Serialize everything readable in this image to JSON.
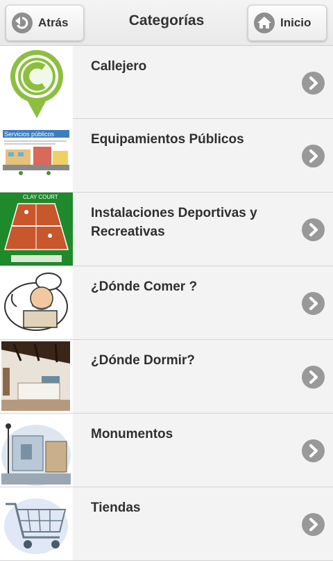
{
  "header": {
    "back_label": "Atrás",
    "title": "Categorías",
    "home_label": "Inicio"
  },
  "thumb_texts": {
    "servicios": "Servicios públicos",
    "clay": "CLAY COURT"
  },
  "categories": [
    {
      "label": "Callejero",
      "icon": "callejero-c-pin"
    },
    {
      "label": "Equipamientos Públicos",
      "icon": "public-services-illustration"
    },
    {
      "label": "Instalaciones Deportivas y Recreativas",
      "icon": "tennis-court-illustration"
    },
    {
      "label": "¿Dónde Comer ?",
      "icon": "chef-illustration"
    },
    {
      "label": "¿Dónde Dormir?",
      "icon": "hotel-room-photo"
    },
    {
      "label": "Monumentos",
      "icon": "monument-watercolor"
    },
    {
      "label": "Tiendas",
      "icon": "shopping-cart-icon"
    }
  ],
  "colors": {
    "pin_green": "#8cbf3f",
    "court_clay": "#c8572c",
    "court_green": "#1f8a2c",
    "chevron": "#999999"
  }
}
